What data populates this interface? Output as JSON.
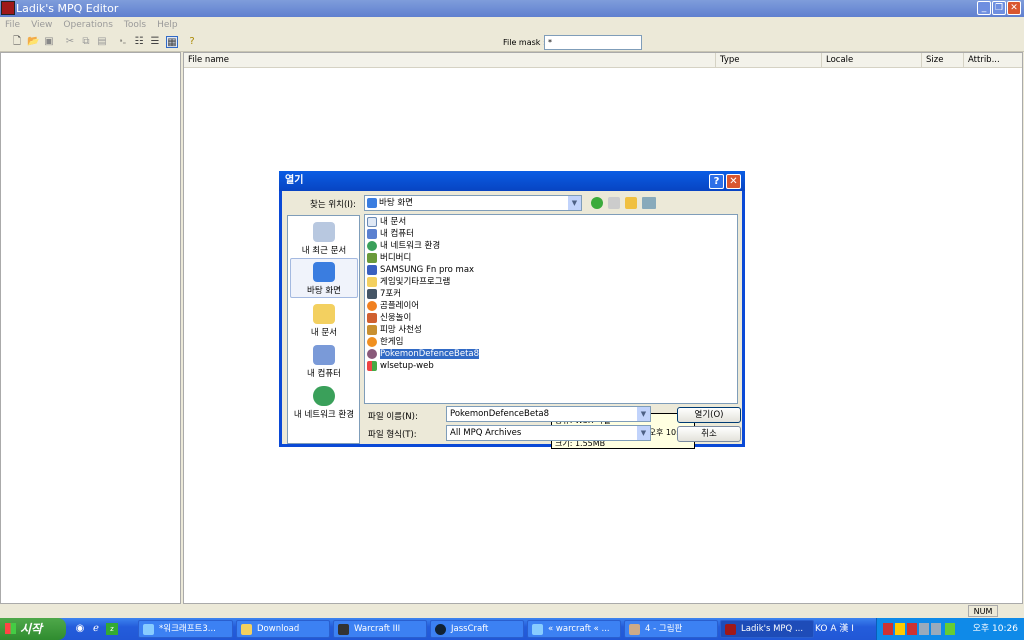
{
  "window": {
    "title": "Ladik's MPQ Editor",
    "controls": [
      "minimize",
      "restore",
      "close"
    ]
  },
  "menu": [
    "File",
    "View",
    "Operations",
    "Tools",
    "Help"
  ],
  "toolbar": {
    "icons": [
      "new-icon",
      "open-icon",
      "save-icon",
      "cut-icon",
      "copy-icon",
      "paste-icon",
      "large-icons-icon",
      "small-icons-icon",
      "list-icon",
      "details-icon",
      "help-icon"
    ],
    "file_mask_label": "File mask :",
    "file_mask_value": "*"
  },
  "columns": [
    "File name",
    "Type",
    "Locale",
    "Size",
    "Attrib..."
  ],
  "status": {
    "num": "NUM"
  },
  "dialog": {
    "title": "열기",
    "look_in_label": "찾는 위치(I):",
    "look_in_value": "바탕 화면",
    "places": [
      "내 최근 문서",
      "바탕 화면",
      "내 문서",
      "내 컴퓨터",
      "내 네트워크 환경"
    ],
    "selected_place": "바탕 화면",
    "files": [
      "내 문서",
      "내 컴퓨터",
      "내 네트워크 환경",
      "버디버디",
      "SAMSUNG Fn pro max",
      "게임및기타프로그램",
      "7포커",
      "곰플레이어",
      "신웅놀이",
      "피망 사천성",
      "한게임",
      "PokemonDefenceBeta8",
      "wlsetup-web"
    ],
    "selected_file": "PokemonDefenceBeta8",
    "tooltip": [
      "종류: W3X 파일",
      "수정한 날짜: 2009-12-17 오후 10:25",
      "크기: 1.55MB"
    ],
    "filename_label": "파일 이름(N):",
    "filename_value": "PokemonDefenceBeta8",
    "filetype_label": "파일 형식(T):",
    "filetype_value": "All MPQ Archives",
    "open_button": "열기(O)",
    "cancel_button": "취소"
  },
  "taskbar": {
    "start": "시작",
    "tasks": [
      "*워크래프트3...",
      "Download",
      "Warcraft III",
      "JassCraft",
      "« warcraft « ...",
      "4 - 그림판",
      "Ladik's MPQ ..."
    ],
    "active_task": "Ladik's MPQ ...",
    "lang": "KO A 漢 I",
    "clock": "오후 10:26"
  },
  "colors": {
    "titlebar": "#0a5de4",
    "selection": "#316ac5",
    "taskbar": "#245ddb",
    "start": "#2f8c2f"
  }
}
